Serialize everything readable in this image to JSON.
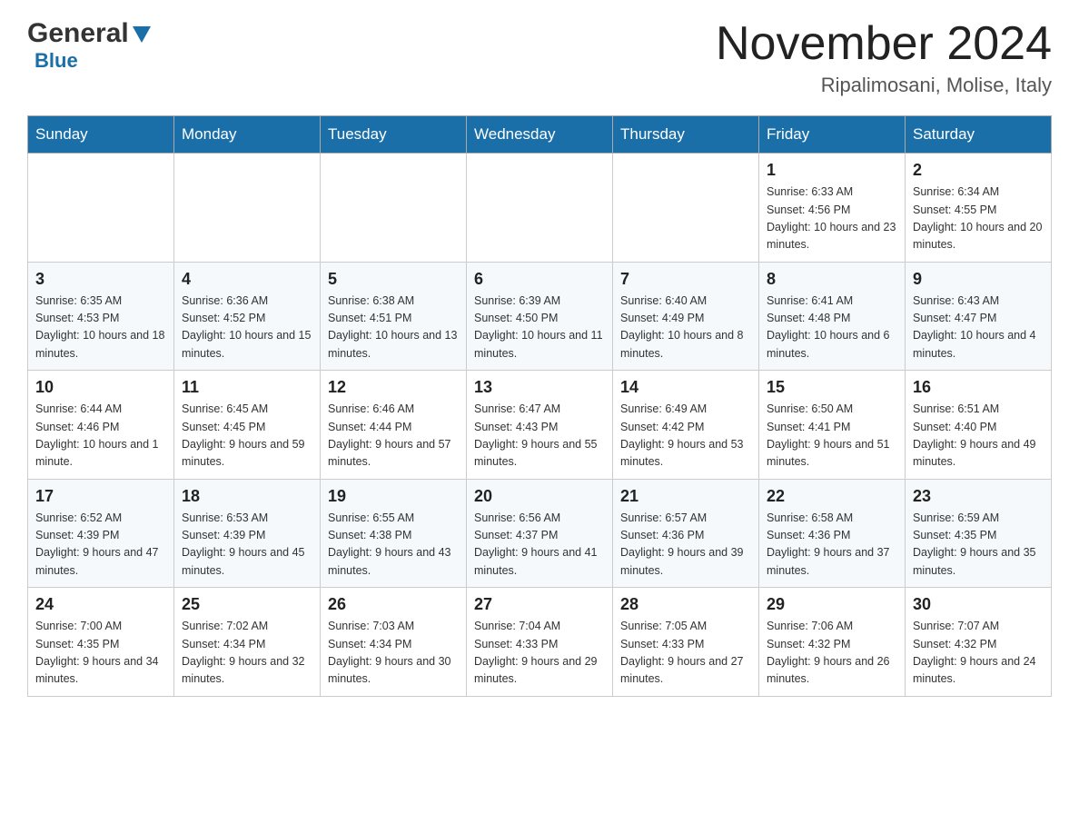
{
  "header": {
    "logo_general": "General",
    "logo_blue": "Blue",
    "month_year": "November 2024",
    "location": "Ripalimosani, Molise, Italy"
  },
  "weekdays": [
    "Sunday",
    "Monday",
    "Tuesday",
    "Wednesday",
    "Thursday",
    "Friday",
    "Saturday"
  ],
  "weeks": [
    {
      "days": [
        {
          "number": "",
          "sunrise": "",
          "sunset": "",
          "daylight": ""
        },
        {
          "number": "",
          "sunrise": "",
          "sunset": "",
          "daylight": ""
        },
        {
          "number": "",
          "sunrise": "",
          "sunset": "",
          "daylight": ""
        },
        {
          "number": "",
          "sunrise": "",
          "sunset": "",
          "daylight": ""
        },
        {
          "number": "",
          "sunrise": "",
          "sunset": "",
          "daylight": ""
        },
        {
          "number": "1",
          "sunrise": "Sunrise: 6:33 AM",
          "sunset": "Sunset: 4:56 PM",
          "daylight": "Daylight: 10 hours and 23 minutes."
        },
        {
          "number": "2",
          "sunrise": "Sunrise: 6:34 AM",
          "sunset": "Sunset: 4:55 PM",
          "daylight": "Daylight: 10 hours and 20 minutes."
        }
      ]
    },
    {
      "days": [
        {
          "number": "3",
          "sunrise": "Sunrise: 6:35 AM",
          "sunset": "Sunset: 4:53 PM",
          "daylight": "Daylight: 10 hours and 18 minutes."
        },
        {
          "number": "4",
          "sunrise": "Sunrise: 6:36 AM",
          "sunset": "Sunset: 4:52 PM",
          "daylight": "Daylight: 10 hours and 15 minutes."
        },
        {
          "number": "5",
          "sunrise": "Sunrise: 6:38 AM",
          "sunset": "Sunset: 4:51 PM",
          "daylight": "Daylight: 10 hours and 13 minutes."
        },
        {
          "number": "6",
          "sunrise": "Sunrise: 6:39 AM",
          "sunset": "Sunset: 4:50 PM",
          "daylight": "Daylight: 10 hours and 11 minutes."
        },
        {
          "number": "7",
          "sunrise": "Sunrise: 6:40 AM",
          "sunset": "Sunset: 4:49 PM",
          "daylight": "Daylight: 10 hours and 8 minutes."
        },
        {
          "number": "8",
          "sunrise": "Sunrise: 6:41 AM",
          "sunset": "Sunset: 4:48 PM",
          "daylight": "Daylight: 10 hours and 6 minutes."
        },
        {
          "number": "9",
          "sunrise": "Sunrise: 6:43 AM",
          "sunset": "Sunset: 4:47 PM",
          "daylight": "Daylight: 10 hours and 4 minutes."
        }
      ]
    },
    {
      "days": [
        {
          "number": "10",
          "sunrise": "Sunrise: 6:44 AM",
          "sunset": "Sunset: 4:46 PM",
          "daylight": "Daylight: 10 hours and 1 minute."
        },
        {
          "number": "11",
          "sunrise": "Sunrise: 6:45 AM",
          "sunset": "Sunset: 4:45 PM",
          "daylight": "Daylight: 9 hours and 59 minutes."
        },
        {
          "number": "12",
          "sunrise": "Sunrise: 6:46 AM",
          "sunset": "Sunset: 4:44 PM",
          "daylight": "Daylight: 9 hours and 57 minutes."
        },
        {
          "number": "13",
          "sunrise": "Sunrise: 6:47 AM",
          "sunset": "Sunset: 4:43 PM",
          "daylight": "Daylight: 9 hours and 55 minutes."
        },
        {
          "number": "14",
          "sunrise": "Sunrise: 6:49 AM",
          "sunset": "Sunset: 4:42 PM",
          "daylight": "Daylight: 9 hours and 53 minutes."
        },
        {
          "number": "15",
          "sunrise": "Sunrise: 6:50 AM",
          "sunset": "Sunset: 4:41 PM",
          "daylight": "Daylight: 9 hours and 51 minutes."
        },
        {
          "number": "16",
          "sunrise": "Sunrise: 6:51 AM",
          "sunset": "Sunset: 4:40 PM",
          "daylight": "Daylight: 9 hours and 49 minutes."
        }
      ]
    },
    {
      "days": [
        {
          "number": "17",
          "sunrise": "Sunrise: 6:52 AM",
          "sunset": "Sunset: 4:39 PM",
          "daylight": "Daylight: 9 hours and 47 minutes."
        },
        {
          "number": "18",
          "sunrise": "Sunrise: 6:53 AM",
          "sunset": "Sunset: 4:39 PM",
          "daylight": "Daylight: 9 hours and 45 minutes."
        },
        {
          "number": "19",
          "sunrise": "Sunrise: 6:55 AM",
          "sunset": "Sunset: 4:38 PM",
          "daylight": "Daylight: 9 hours and 43 minutes."
        },
        {
          "number": "20",
          "sunrise": "Sunrise: 6:56 AM",
          "sunset": "Sunset: 4:37 PM",
          "daylight": "Daylight: 9 hours and 41 minutes."
        },
        {
          "number": "21",
          "sunrise": "Sunrise: 6:57 AM",
          "sunset": "Sunset: 4:36 PM",
          "daylight": "Daylight: 9 hours and 39 minutes."
        },
        {
          "number": "22",
          "sunrise": "Sunrise: 6:58 AM",
          "sunset": "Sunset: 4:36 PM",
          "daylight": "Daylight: 9 hours and 37 minutes."
        },
        {
          "number": "23",
          "sunrise": "Sunrise: 6:59 AM",
          "sunset": "Sunset: 4:35 PM",
          "daylight": "Daylight: 9 hours and 35 minutes."
        }
      ]
    },
    {
      "days": [
        {
          "number": "24",
          "sunrise": "Sunrise: 7:00 AM",
          "sunset": "Sunset: 4:35 PM",
          "daylight": "Daylight: 9 hours and 34 minutes."
        },
        {
          "number": "25",
          "sunrise": "Sunrise: 7:02 AM",
          "sunset": "Sunset: 4:34 PM",
          "daylight": "Daylight: 9 hours and 32 minutes."
        },
        {
          "number": "26",
          "sunrise": "Sunrise: 7:03 AM",
          "sunset": "Sunset: 4:34 PM",
          "daylight": "Daylight: 9 hours and 30 minutes."
        },
        {
          "number": "27",
          "sunrise": "Sunrise: 7:04 AM",
          "sunset": "Sunset: 4:33 PM",
          "daylight": "Daylight: 9 hours and 29 minutes."
        },
        {
          "number": "28",
          "sunrise": "Sunrise: 7:05 AM",
          "sunset": "Sunset: 4:33 PM",
          "daylight": "Daylight: 9 hours and 27 minutes."
        },
        {
          "number": "29",
          "sunrise": "Sunrise: 7:06 AM",
          "sunset": "Sunset: 4:32 PM",
          "daylight": "Daylight: 9 hours and 26 minutes."
        },
        {
          "number": "30",
          "sunrise": "Sunrise: 7:07 AM",
          "sunset": "Sunset: 4:32 PM",
          "daylight": "Daylight: 9 hours and 24 minutes."
        }
      ]
    }
  ]
}
